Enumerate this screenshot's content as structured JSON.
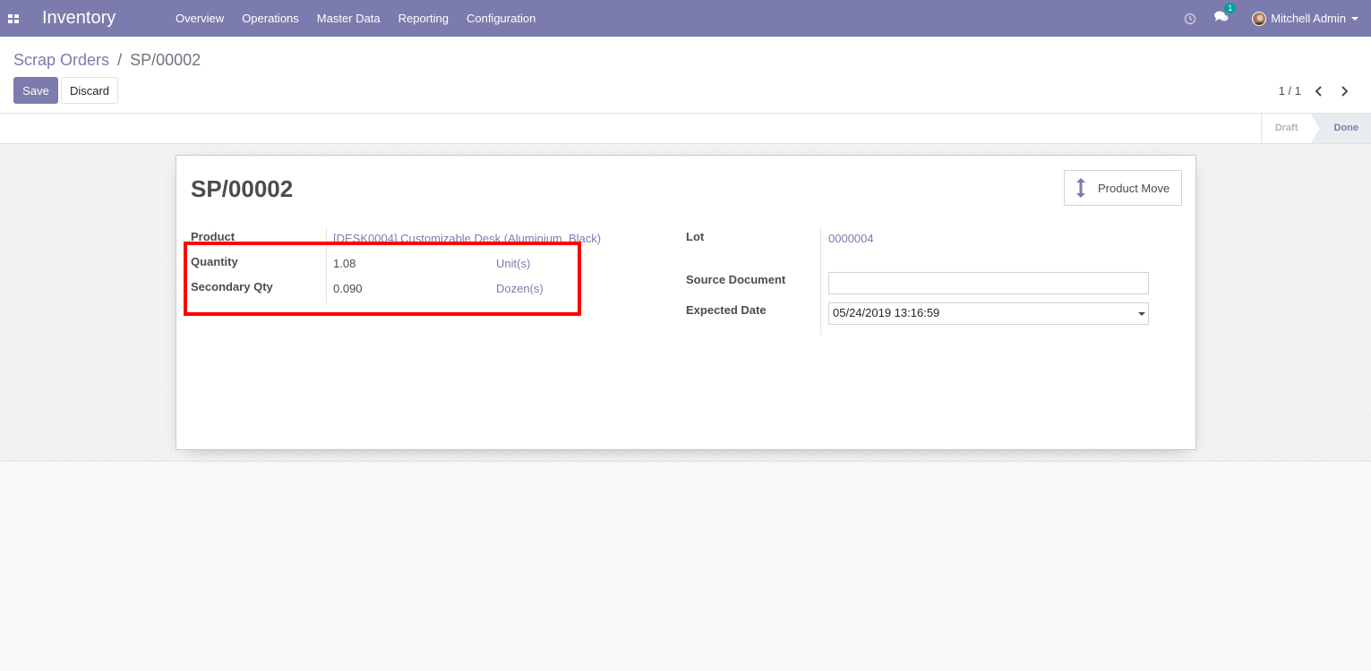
{
  "navbar": {
    "app_title": "Inventory",
    "menu": [
      "Overview",
      "Operations",
      "Master Data",
      "Reporting",
      "Configuration"
    ],
    "chat_badge": "1",
    "user_name": "Mitchell Admin",
    "bg_color": "#7c7bad"
  },
  "breadcrumb": {
    "parent": "Scrap Orders",
    "separator": "/",
    "current": "SP/00002"
  },
  "actions": {
    "save_label": "Save",
    "discard_label": "Discard"
  },
  "pager": {
    "value": "1 / 1"
  },
  "statusbar": {
    "stages": [
      "Draft",
      "Done"
    ],
    "active_stage": "Done"
  },
  "form": {
    "title": "SP/00002",
    "smart_button_label": "Product Move",
    "left": {
      "product_label": "Product",
      "product_value": "[DESK0004] Customizable Desk (Aluminium, Black)",
      "quantity_label": "Quantity",
      "quantity_value": "1.08",
      "quantity_uom": "Unit(s)",
      "secondary_qty_label": "Secondary Qty",
      "secondary_qty_value": "0.090",
      "secondary_qty_uom": "Dozen(s)"
    },
    "right": {
      "lot_label": "Lot",
      "lot_value": "0000004",
      "source_document_label": "Source Document",
      "source_document_value": "",
      "expected_date_label": "Expected Date",
      "expected_date_value": "05/24/2019 13:16:59"
    }
  },
  "annotation": {
    "highlight_color": "#ff0000"
  },
  "icons": {
    "apps": "apps-grid-icon",
    "clock": "clock-icon",
    "chat": "chat-icon",
    "pager_prev": "chevron-left-icon",
    "pager_next": "chevron-right-icon",
    "product_move": "vertical-arrows-icon"
  }
}
